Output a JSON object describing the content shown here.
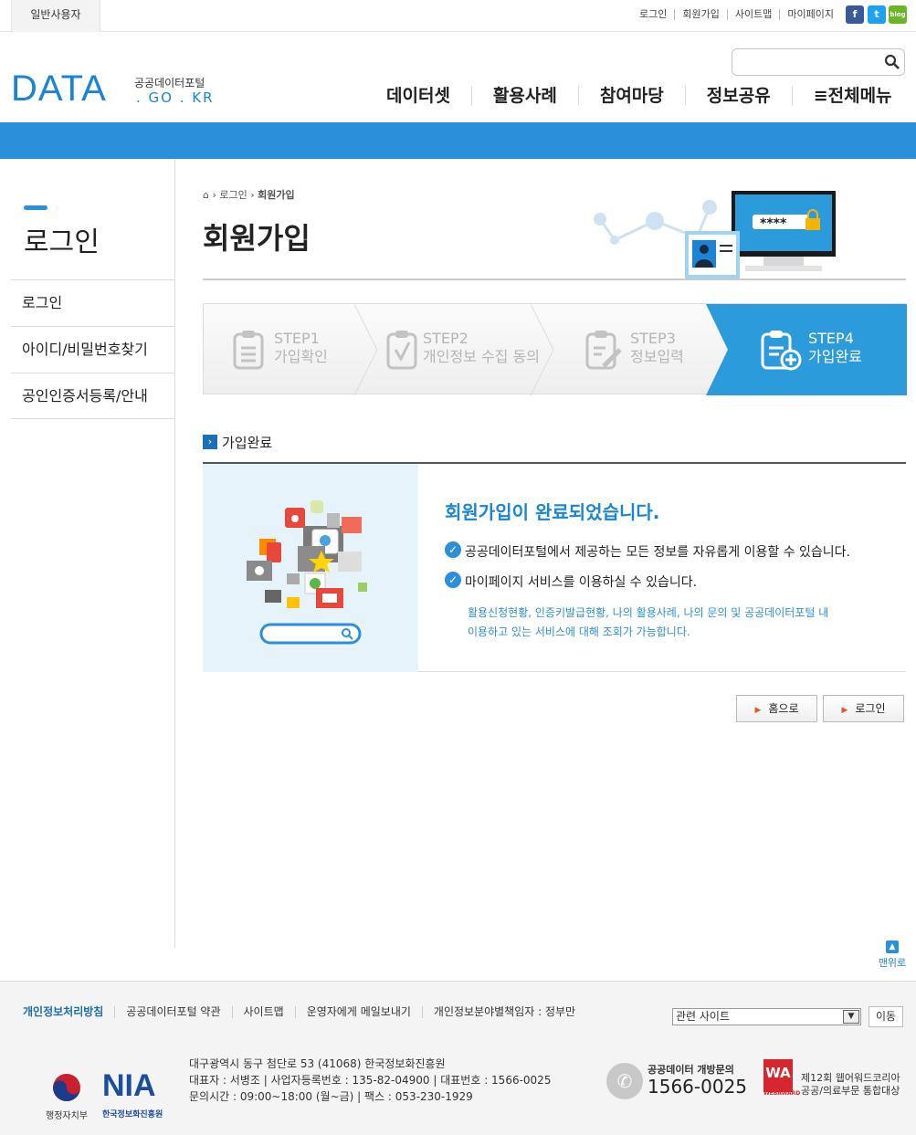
{
  "topbar": {
    "user_tab": "일반사용자",
    "links": [
      "로그인",
      "회원가입",
      "사이트맵",
      "마이페이지"
    ],
    "sns": [
      {
        "name": "facebook-icon",
        "glyph": "f",
        "color": "#3b5998"
      },
      {
        "name": "twitter-icon",
        "glyph": "t",
        "color": "#1da1f2"
      },
      {
        "name": "blog-icon",
        "glyph": "blog",
        "color": "#6ab528"
      }
    ]
  },
  "header": {
    "logo_main": "DATA",
    "logo_sub1": "공공데이터포털",
    "logo_sub2": ". GO . KR",
    "search_placeholder": "",
    "nav": [
      "데이터셋",
      "활용사례",
      "참여마당",
      "정보공유",
      "≡전체메뉴"
    ]
  },
  "sidebar": {
    "title": "로그인",
    "items": [
      "로그인",
      "아이디/비밀번호찾기",
      "공인인증서등록/안내"
    ]
  },
  "main": {
    "breadcrumb": [
      "로그인",
      "회원가입"
    ],
    "title": "회원가입",
    "password_mask": "****",
    "steps": [
      {
        "num": "STEP1",
        "label": "가입확인",
        "active": false
      },
      {
        "num": "STEP2",
        "label": "개인정보 수집 동의",
        "active": false
      },
      {
        "num": "STEP3",
        "label": "정보입력",
        "active": false
      },
      {
        "num": "STEP4",
        "label": "가입완료",
        "active": true
      }
    ],
    "section_title": "가입완료",
    "done_title": "회원가입이 완료되었습니다.",
    "line1": "공공데이터포털에서 제공하는 모든 정보를 자유롭게 이용할 수 있습니다.",
    "line2": "마이페이지 서비스를 이용하실 수 있습니다.",
    "sub1": "활용신청현황, 인증키발급현황, 나의 활용사례, 나의 문의 및 공공데이터포털 내",
    "sub2": "이용하고 있는 서비스에 대해 조회가 가능합니다.",
    "btn_home": "홈으로",
    "btn_login": "로그인",
    "to_top": "맨위로"
  },
  "footer": {
    "links": [
      "개인정보처리방침",
      "공공데이터포털 약관",
      "사이트맵",
      "운영자에게 메일보내기",
      "개인정보분야별책임자 : 정부만"
    ],
    "select_label": "관련 사이트",
    "go_label": "이동",
    "addr1": "대구광역시 동구 첨단로 53 (41068) 한국정보화진흥원",
    "addr2": "대표자 : 서병조 | 사업자등록번호 : 135-82-04900 | 대표번호 : 1566-0025",
    "addr3": "문의시간 : 09:00~18:00 (월~금) | 팩스 : 053-230-1929",
    "gov_label": "행정자치부",
    "nia_logo": "NIA",
    "nia_label": "한국정보화진흥원",
    "tel_caption": "공공데이터 개방문의",
    "tel": "1566-0025",
    "award_line1": "제12회 웹어워드코리아",
    "award_line2": "공공/의료부문 통합대상",
    "award_badge": "WA",
    "award_badge_text": "WEBAWARD"
  },
  "colors": {
    "accent": "#2c8fd9",
    "brand": "#1a85d6",
    "step_active": "#2c9bdc"
  }
}
